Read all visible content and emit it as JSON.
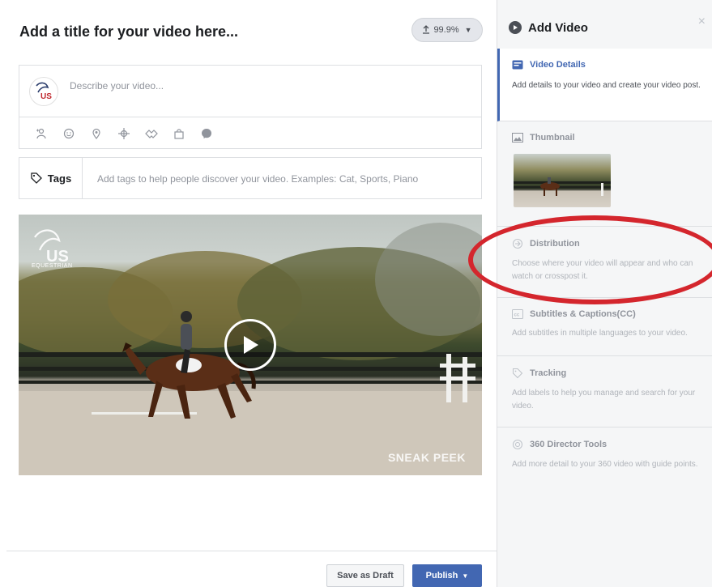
{
  "editor": {
    "title_placeholder": "Add a title for your video here...",
    "upload_progress": "99.9%",
    "describe_placeholder": "Describe your video...",
    "avatar_text": "US",
    "tags_label": "Tags",
    "tags_placeholder": "Add tags to help people discover your video. Examples: Cat, Sports, Piano",
    "video": {
      "logo_text": "EQUESTRIAN",
      "overlay_text": "SNEAK PEEK"
    },
    "buttons": {
      "save_draft": "Save as Draft",
      "publish": "Publish"
    }
  },
  "sidebar": {
    "title": "Add Video",
    "close": "×",
    "items": [
      {
        "id": "video-details",
        "label": "Video Details",
        "desc": "Add details to your video and create your video post.",
        "active": true
      },
      {
        "id": "thumbnail",
        "label": "Thumbnail",
        "desc": ""
      },
      {
        "id": "distribution",
        "label": "Distribution",
        "desc": "Choose where your video will appear and who can watch or crosspost it."
      },
      {
        "id": "subtitles",
        "label": "Subtitles & Captions(CC)",
        "desc": "Add subtitles in multiple languages to your video."
      },
      {
        "id": "tracking",
        "label": "Tracking",
        "desc": "Add labels to help you manage and search for your video."
      },
      {
        "id": "director-tools",
        "label": "360 Director Tools",
        "desc": "Add more detail to your 360 video with guide points."
      }
    ]
  },
  "colors": {
    "accent": "#4267b2",
    "highlight_ellipse": "#d4262d"
  }
}
